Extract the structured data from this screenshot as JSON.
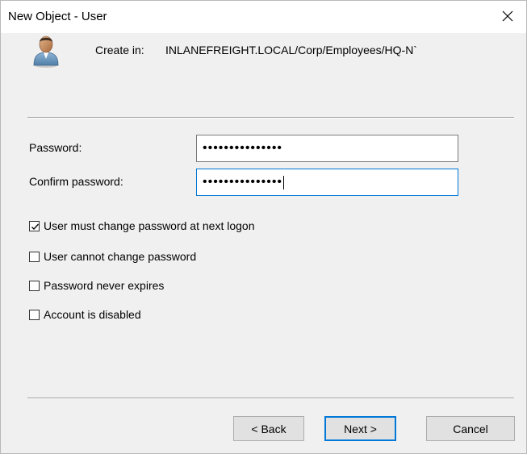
{
  "window": {
    "title": "New Object - User"
  },
  "header": {
    "create_in_label": "Create in:",
    "create_in_path": "INLANEFREIGHT.LOCAL/Corp/Employees/HQ-N`"
  },
  "form": {
    "password_label": "Password:",
    "password_value": "•••••••••••••••",
    "confirm_label": "Confirm password:",
    "confirm_value": "•••••••••••••••"
  },
  "options": [
    {
      "label": "User must change password at next logon",
      "checked": true
    },
    {
      "label": "User cannot change password",
      "checked": false
    },
    {
      "label": "Password never expires",
      "checked": false
    },
    {
      "label": "Account is disabled",
      "checked": false
    }
  ],
  "buttons": {
    "back": "< Back",
    "next": "Next >",
    "cancel": "Cancel"
  },
  "icons": {
    "close": "close-icon",
    "user": "user-icon"
  }
}
